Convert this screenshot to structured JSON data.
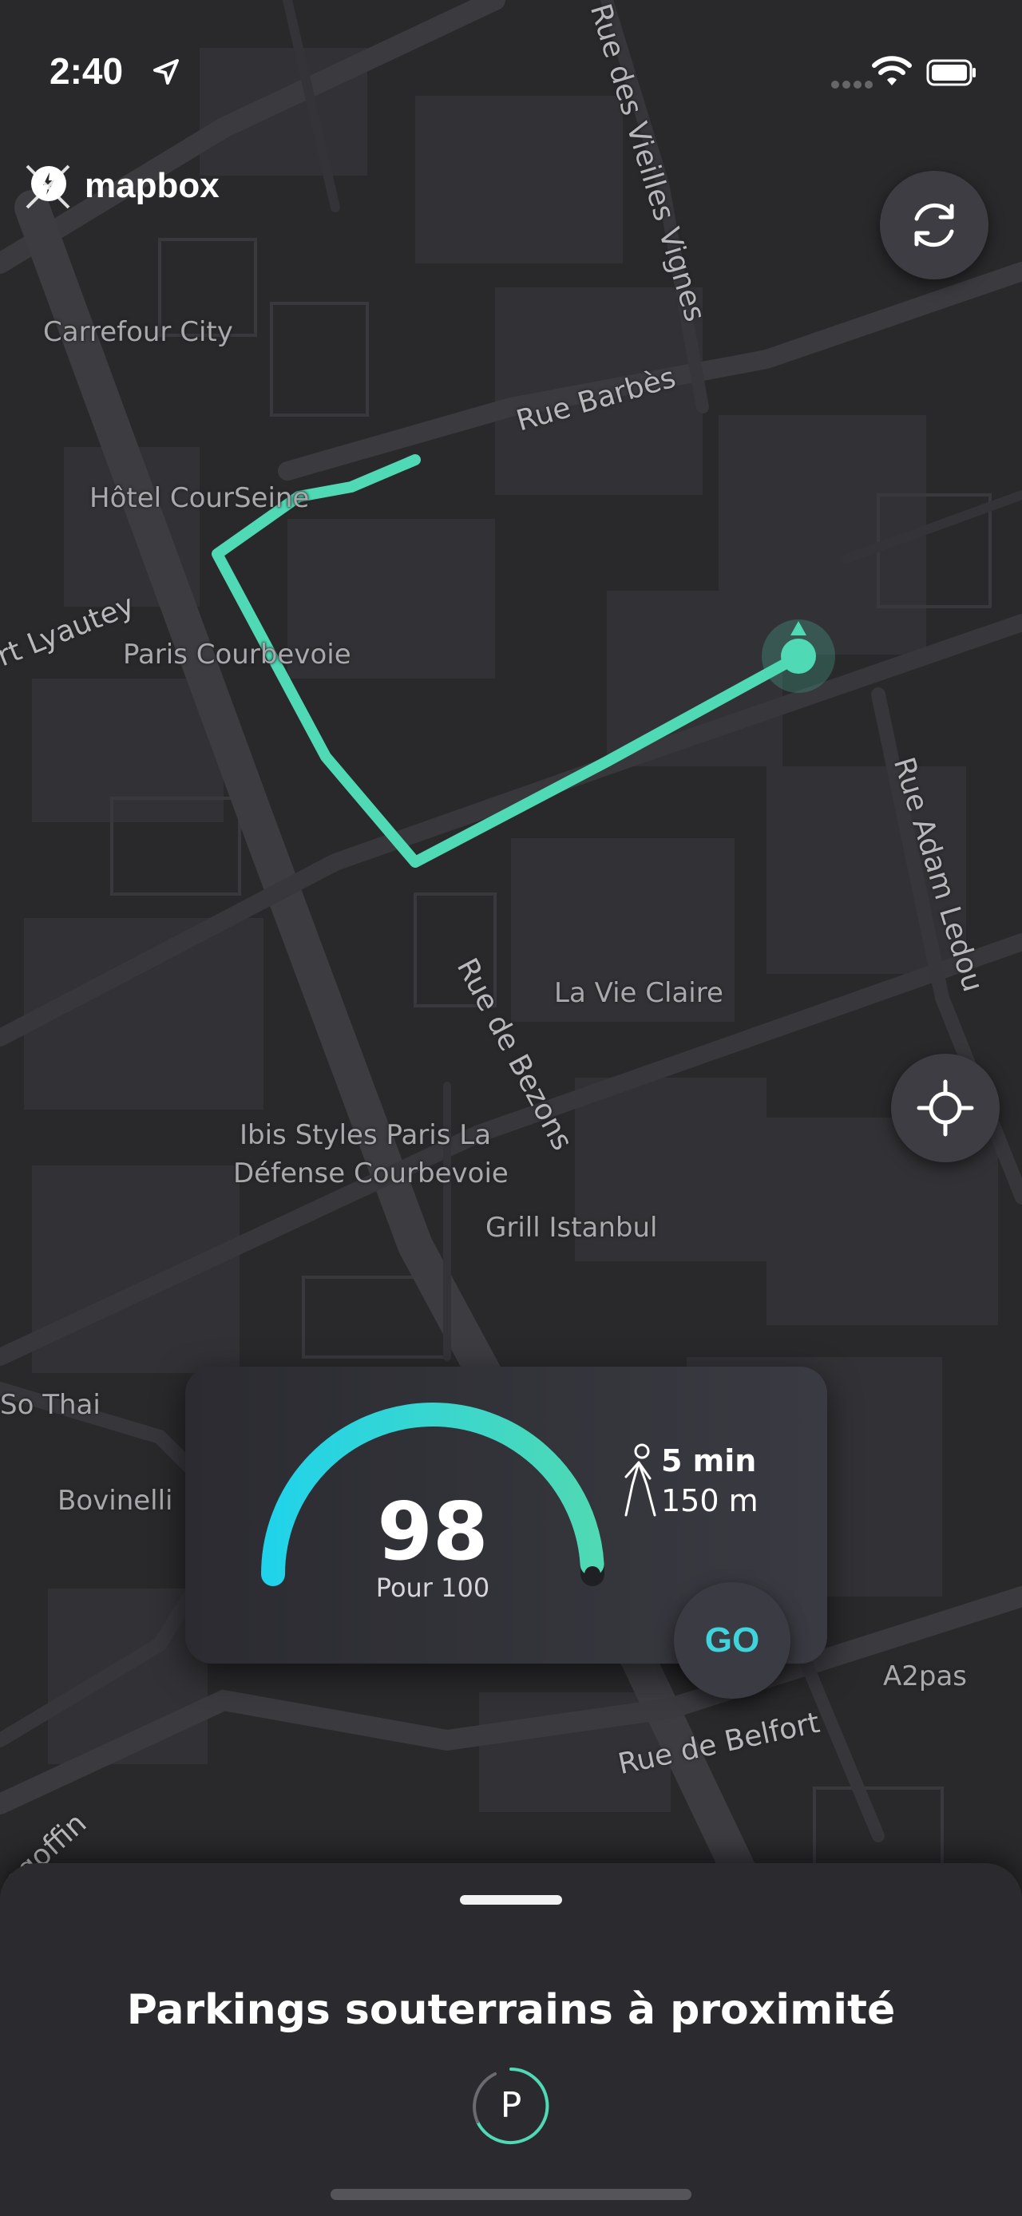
{
  "status_bar": {
    "time": "2:40"
  },
  "map": {
    "attribution": "mapbox",
    "pois": [
      "Carrefour City",
      "Hôtel CourSeine",
      "Paris Courbevoie",
      "La Vie Claire",
      "Ibis Styles Paris La",
      "Défense Courbevoie",
      "Grill Istanbul",
      "So Thai",
      "Bovinelli",
      "A2pas"
    ],
    "streets": [
      "Rue des Vieilles Vignes",
      "Rue Barbès",
      "rt Lyautey",
      "Rue Adam Ledou",
      "Rue de Bezons",
      "Rue de Belfort",
      "egoffin"
    ],
    "route_color": "#4fd9b4"
  },
  "score_card": {
    "score": "98",
    "caption": "Pour 100",
    "score_fraction": 0.98,
    "walk_time": "5 min",
    "walk_distance": "150 m",
    "go_label": "GO",
    "gauge_colors": [
      "#21d3ea",
      "#4fd9b4"
    ]
  },
  "bottom_sheet": {
    "title": "Parkings souterrains à proximité",
    "parking_icon_label": "P"
  },
  "icons": [
    "location-arrow-icon",
    "wifi-icon",
    "battery-icon",
    "refresh-icon",
    "crosshair-icon",
    "walking-person-icon",
    "parking-icon"
  ]
}
